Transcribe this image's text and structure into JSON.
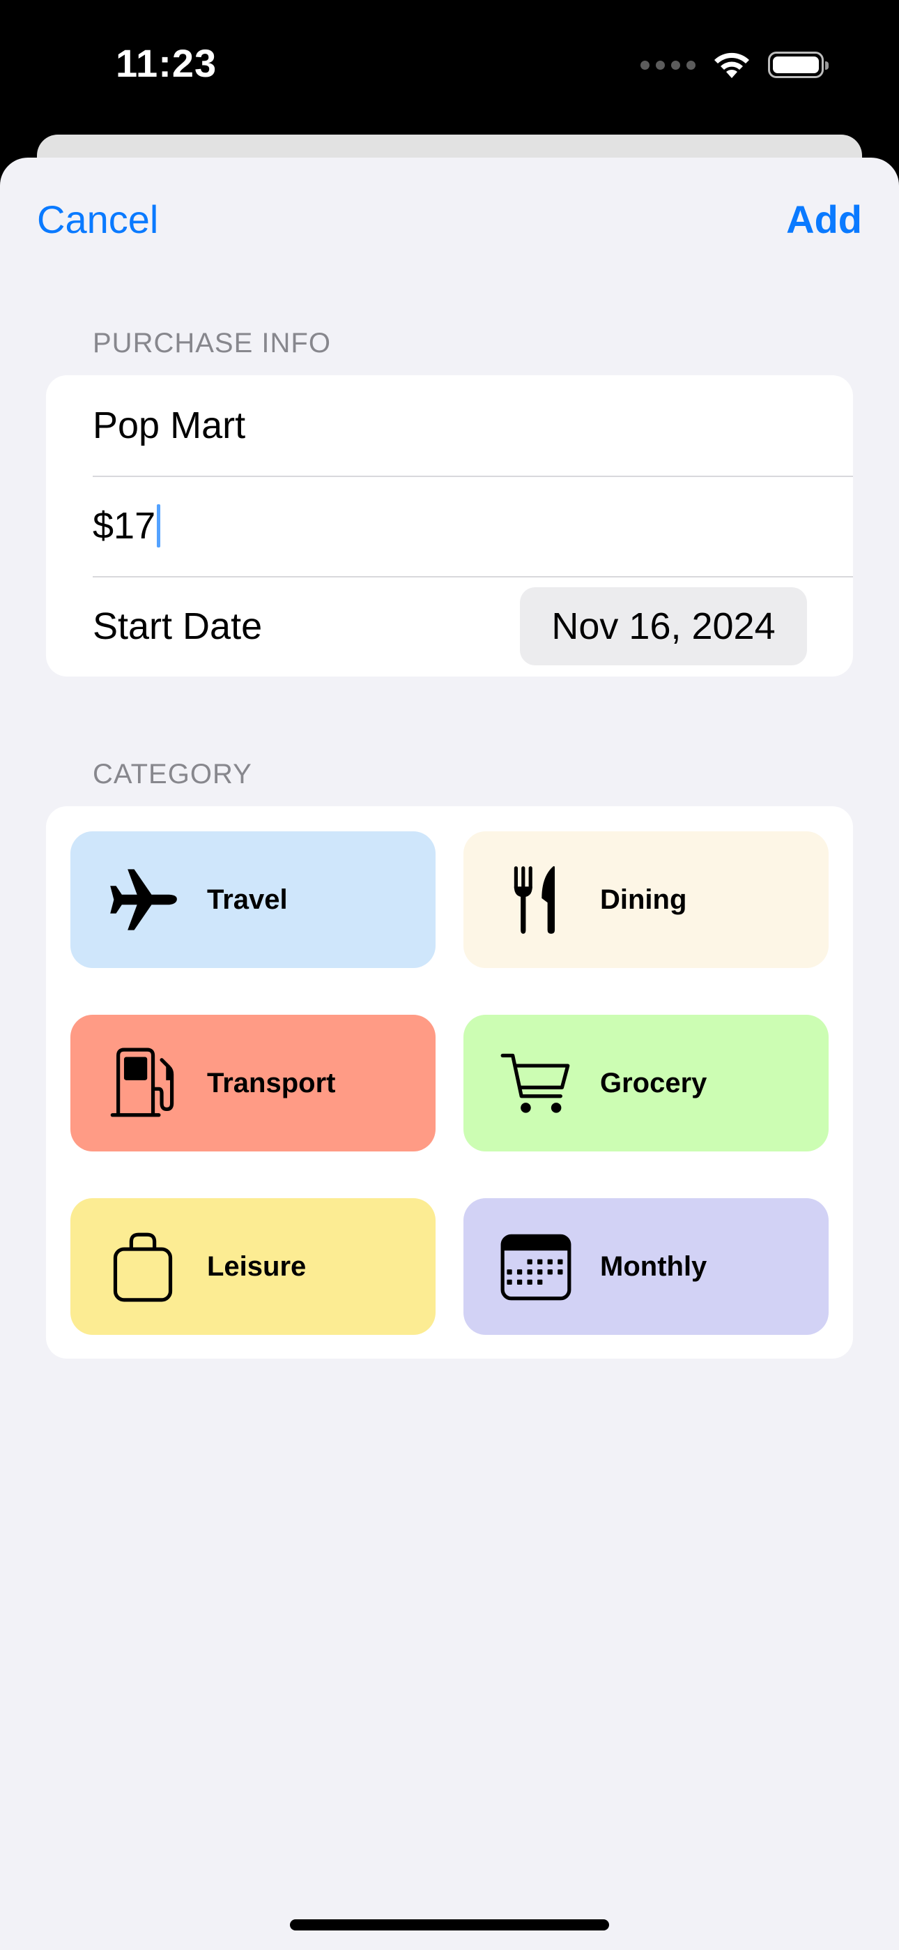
{
  "status_bar": {
    "time": "11:23"
  },
  "nav": {
    "cancel_label": "Cancel",
    "add_label": "Add"
  },
  "purchase_info": {
    "header": "PURCHASE INFO",
    "name_value": "Pop Mart",
    "amount_value": "$17",
    "start_date_label": "Start Date",
    "start_date_value": "Nov 16, 2024"
  },
  "category": {
    "header": "CATEGORY",
    "items": [
      {
        "label": "Travel",
        "icon": "airplane-icon",
        "color": "#cfe6fb"
      },
      {
        "label": "Dining",
        "icon": "fork-knife-icon",
        "color": "#fdf6e6"
      },
      {
        "label": "Transport",
        "icon": "fuel-pump-icon",
        "color": "#ff9b85"
      },
      {
        "label": "Grocery",
        "icon": "cart-icon",
        "color": "#ccfdb3"
      },
      {
        "label": "Leisure",
        "icon": "bag-icon",
        "color": "#fcec93"
      },
      {
        "label": "Monthly",
        "icon": "calendar-icon",
        "color": "#d2d2f5"
      }
    ]
  },
  "colors": {
    "accent": "#0a7aff",
    "sheet_background": "#f2f2f7"
  }
}
